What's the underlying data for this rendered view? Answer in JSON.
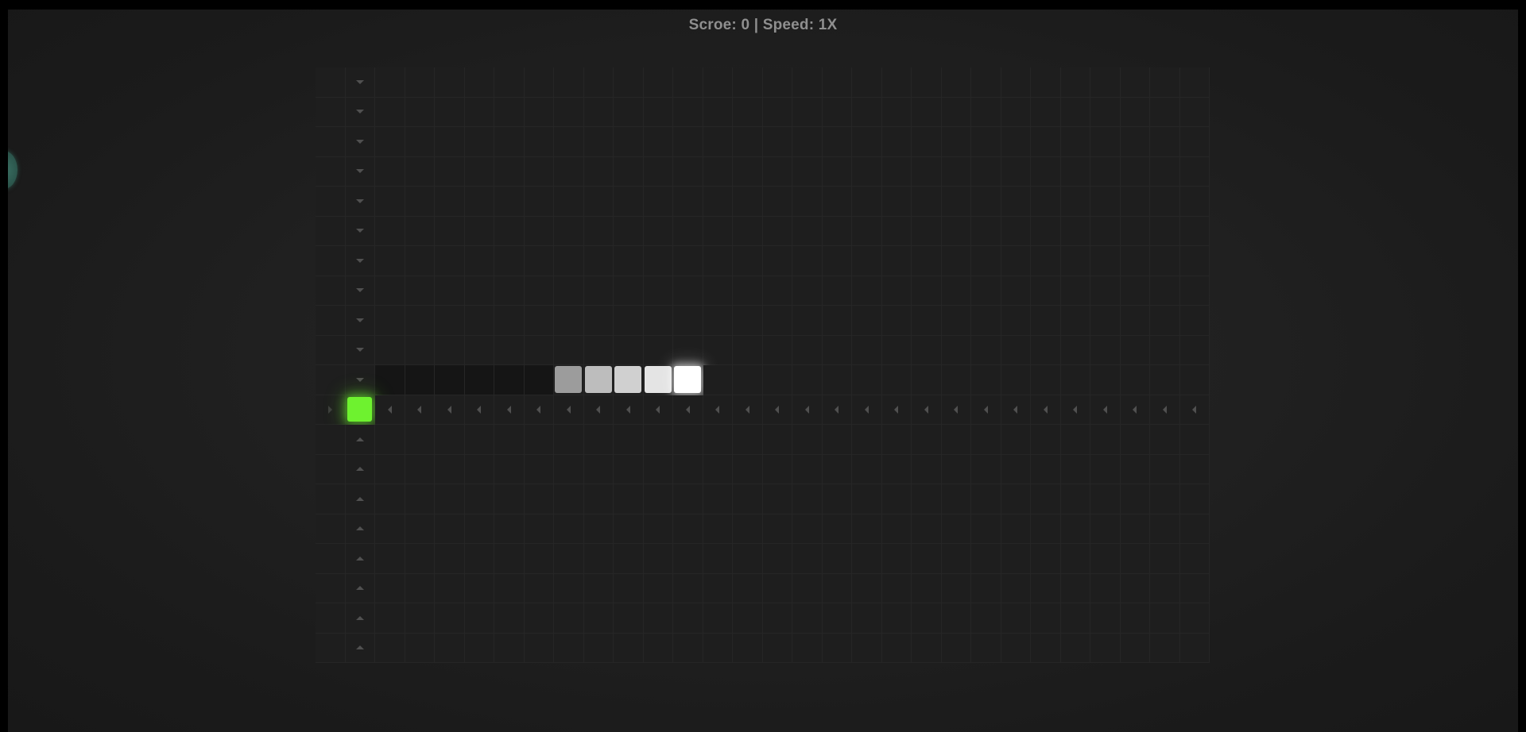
{
  "hud": {
    "score_label": "Scroe",
    "score_value": "0",
    "speed_label": "Speed",
    "speed_value": "1X",
    "text": "Scroe: 0 | Speed: 1X"
  },
  "board": {
    "columns": 30,
    "rows": 20
  },
  "game": {
    "snake": [
      {
        "col": 12,
        "row": 10,
        "shade": "#ffffff",
        "head": true
      },
      {
        "col": 11,
        "row": 10,
        "shade": "#e4e4e4"
      },
      {
        "col": 10,
        "row": 10,
        "shade": "#d0d0d0"
      },
      {
        "col": 9,
        "row": 10,
        "shade": "#bdbdbd"
      },
      {
        "col": 8,
        "row": 10,
        "shade": "#9c9c9c"
      }
    ],
    "trail": [
      {
        "col": 2,
        "row": 10
      },
      {
        "col": 3,
        "row": 10
      },
      {
        "col": 4,
        "row": 10
      },
      {
        "col": 5,
        "row": 10
      },
      {
        "col": 6,
        "row": 10
      },
      {
        "col": 7,
        "row": 10
      }
    ],
    "food": {
      "col": 1,
      "row": 11,
      "color": "#6ef22f"
    },
    "path_arrows": {
      "vertical_col": 1,
      "down_rows": [
        0,
        1,
        2,
        3,
        4,
        5,
        6,
        7,
        8,
        9,
        10
      ],
      "up_rows": [
        12,
        13,
        14,
        15,
        16,
        17,
        18,
        19
      ],
      "horizontal_row": 11,
      "right_cols": [
        0
      ],
      "left_cols": [
        2,
        3,
        4,
        5,
        6,
        7,
        8,
        9,
        10,
        11,
        12,
        13,
        14,
        15,
        16,
        17,
        18,
        19,
        20,
        21,
        22,
        23,
        24,
        25,
        26,
        27,
        28,
        29
      ]
    }
  },
  "colors": {
    "background": "#000000",
    "panel": "#222222",
    "grid_line": "#262626",
    "hud_text": "#8f8f8f",
    "food": "#6ef22f",
    "handle": "#2e5a50"
  }
}
